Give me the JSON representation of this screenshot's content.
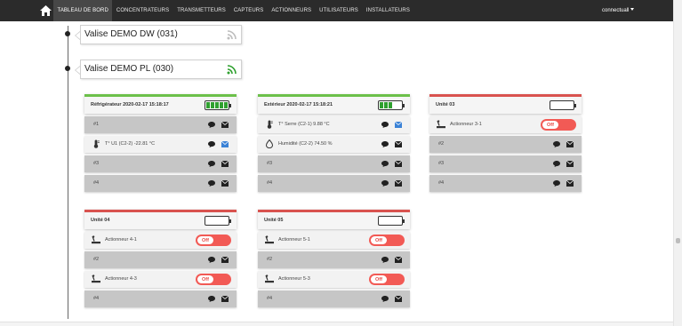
{
  "nav": {
    "items": [
      {
        "label": "TABLEAU DE BORD",
        "active": true
      },
      {
        "label": "CONCENTRATEURS",
        "active": false
      },
      {
        "label": "TRANSMETTEURS",
        "active": false
      },
      {
        "label": "CAPTEURS",
        "active": false
      },
      {
        "label": "ACTIONNEURS",
        "active": false
      },
      {
        "label": "UTILISATEURS",
        "active": false
      },
      {
        "label": "INSTALLATEURS",
        "active": false
      }
    ],
    "user": "connectuall"
  },
  "valises": [
    {
      "title": "Valise DEMO DW (031)",
      "wifi_color": "#bdbdbd"
    },
    {
      "title": "Valise DEMO PL (030)",
      "wifi_color": "#2fa02f"
    }
  ],
  "cards": {
    "refrigerateur": {
      "title": "Réfrigérateur  2020-02-17 15:18:17",
      "battery_level": 1.0,
      "rows": [
        {
          "label": "#1"
        },
        {
          "label": "T° U1 (C2-2)  -22.81 °C",
          "icon": "thermometer-icon",
          "mail_active": true
        },
        {
          "label": "#3"
        },
        {
          "label": "#4"
        }
      ]
    },
    "exterieur": {
      "title": "Extérieur      2020-02-17 15:18:21",
      "battery_level": 0.6,
      "rows": [
        {
          "label": "T° Serre (C2-1)  9.88 °C",
          "icon": "thermometer-icon",
          "mail_active": true
        },
        {
          "label": "Humidité (C2-2)  74.50 %",
          "icon": "humidity-icon"
        },
        {
          "label": "#3"
        },
        {
          "label": "#4"
        }
      ]
    },
    "unite03": {
      "title": "Unité 03",
      "battery_level": 0.0,
      "rows": [
        {
          "label": "Actionneur 3-1",
          "toggle": "Off"
        },
        {
          "label": "#2"
        },
        {
          "label": "#3"
        },
        {
          "label": "#4"
        }
      ]
    },
    "unite04": {
      "title": "Unité 04",
      "battery_level": 0.0,
      "rows": [
        {
          "label": "Actionneur 4-1",
          "toggle": "Off"
        },
        {
          "label": "#2"
        },
        {
          "label": "Actionneur 4-3",
          "toggle": "Off"
        },
        {
          "label": "#4"
        }
      ]
    },
    "unite05": {
      "title": "Unité 05",
      "battery_level": 0.0,
      "rows": [
        {
          "label": "Actionneur 5-1",
          "toggle": "Off"
        },
        {
          "label": "#2"
        },
        {
          "label": "Actionneur 5-3",
          "toggle": "Off"
        },
        {
          "label": "#4"
        }
      ]
    }
  },
  "colors": {
    "ok_border": "#6cc04a",
    "alert_border": "#d9534f",
    "toggle_off": "#f25a55",
    "mail_active": "#3b82d6"
  }
}
